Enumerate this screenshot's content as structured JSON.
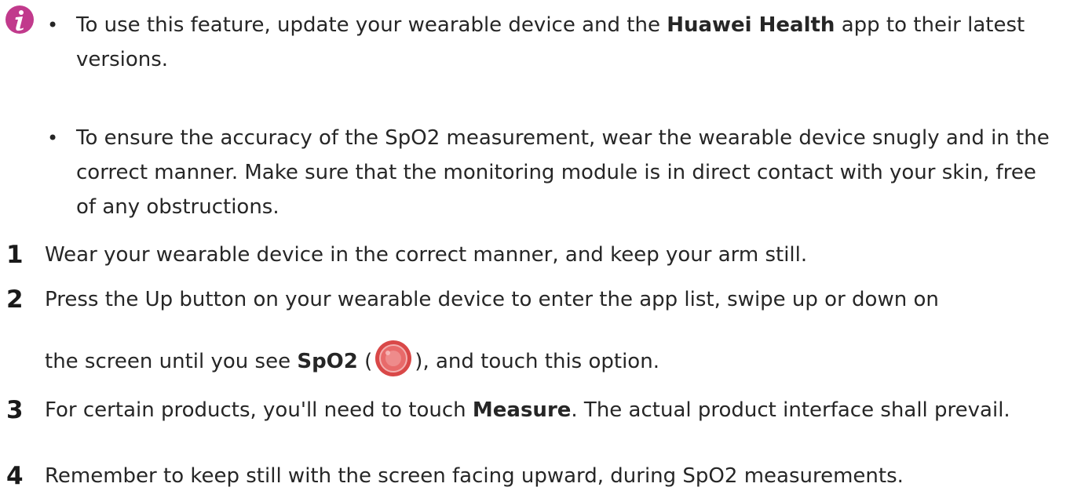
{
  "note": {
    "items": [
      {
        "before": "To use this feature, update your wearable device and the ",
        "bold": "Huawei Health",
        "after": " app to their latest versions."
      },
      {
        "text": "To ensure the accuracy of the SpO2 measurement, wear the wearable device snugly and in the correct manner. Make sure that the monitoring module is in direct contact with your skin, free of any obstructions."
      }
    ],
    "bullet": "•",
    "icon": "info-icon",
    "icon_color": "#c13a8c"
  },
  "steps": [
    {
      "number": "1",
      "text": "Wear your wearable device in the correct manner, and keep your arm still."
    },
    {
      "number": "2",
      "line1": "Press the Up button on your wearable device to enter the app list, swipe up or down on",
      "before": "the screen until you see ",
      "bold": "SpO2",
      "paren_open": " (",
      "paren_close": "), and touch this option.",
      "icon": "spo2-app-icon",
      "icon_color": "#e05a5a"
    },
    {
      "number": "3",
      "before": "For certain products, you'll need to touch ",
      "bold": "Measure",
      "after": ". The actual product interface shall prevail."
    },
    {
      "number": "4",
      "text": "Remember to keep still with the screen facing upward, during SpO2 measurements."
    }
  ]
}
